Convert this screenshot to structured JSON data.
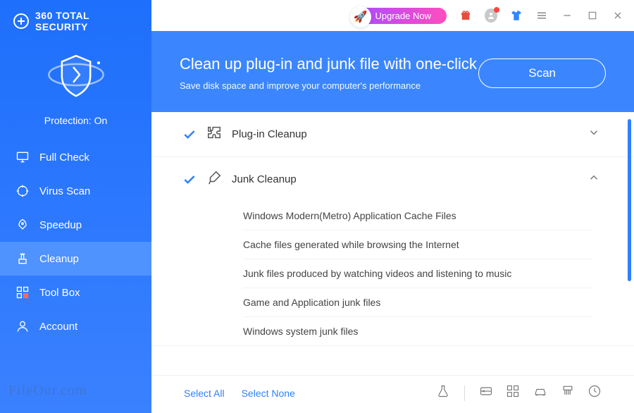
{
  "brand": {
    "name": "360 TOTAL SECURITY"
  },
  "protection": {
    "status": "Protection: On"
  },
  "sidebar": {
    "items": [
      {
        "label": "Full Check"
      },
      {
        "label": "Virus Scan"
      },
      {
        "label": "Speedup"
      },
      {
        "label": "Cleanup"
      },
      {
        "label": "Tool Box"
      },
      {
        "label": "Account"
      }
    ],
    "active_index": 3
  },
  "titlebar": {
    "upgrade_label": "Upgrade Now"
  },
  "hero": {
    "title": "Clean up plug-in and junk file with one-click",
    "subtitle": "Save disk space and improve your computer's performance",
    "scan_label": "Scan"
  },
  "groups": [
    {
      "label": "Plug-in Cleanup",
      "checked": true,
      "expanded": false
    },
    {
      "label": "Junk Cleanup",
      "checked": true,
      "expanded": true,
      "items": [
        "Windows Modern(Metro) Application Cache Files",
        "Cache files generated while browsing the Internet",
        "Junk files produced by watching videos and listening to music",
        "Game and Application junk files",
        "Windows system junk files"
      ]
    }
  ],
  "footer": {
    "select_all": "Select All",
    "select_none": "Select None"
  },
  "watermark": "FileOur.com"
}
